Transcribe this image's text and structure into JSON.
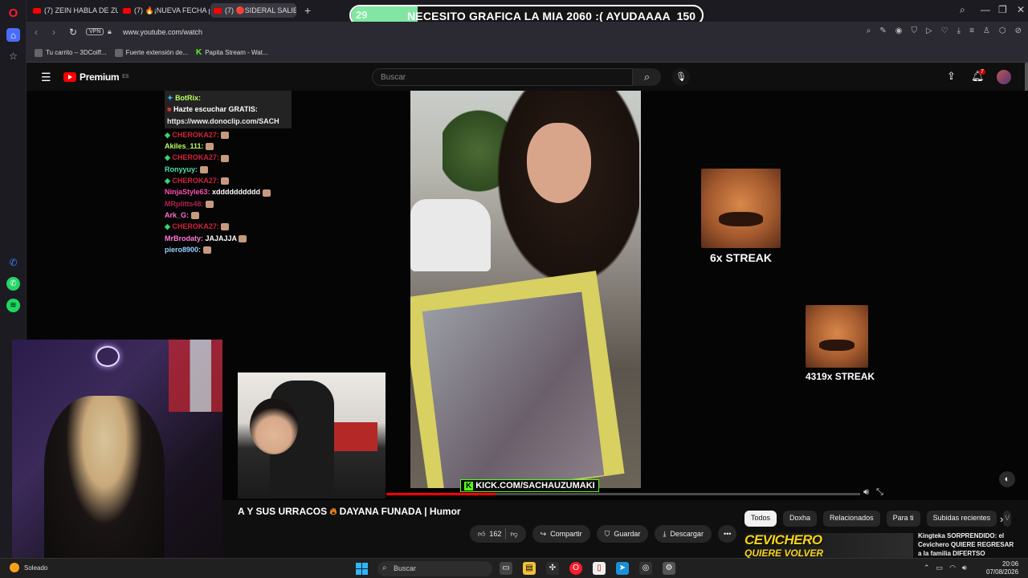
{
  "browser": {
    "tabs": [
      {
        "label": "(7) ZEIN HABLA DE ZULLY"
      },
      {
        "label": "(7) 🔥¡NUEVA FECHA par"
      },
      {
        "label": "(7) 🔴SIDERAL SALIE",
        "active": true
      }
    ],
    "url": "www.youtube.com/watch",
    "vpn_label": "VPN",
    "bookmarks": [
      {
        "label": "Tu carrito – 3DCoiff..."
      },
      {
        "label": "Fuerte extensión de..."
      },
      {
        "label": "Papita Stream - Wat..."
      }
    ]
  },
  "stream_overlay": {
    "left_number": "29",
    "goal_text": "NECESITO GRAFICA LA MIA 2060 :( AYUDAAAA",
    "right_number": "150",
    "progress_fraction": 0.19,
    "fill_color": "#82e6a2"
  },
  "youtube": {
    "logo_text": "Premium",
    "region": "ES",
    "search_placeholder": "Buscar",
    "notification_count": "7"
  },
  "chat": {
    "bot_name": "BotRix:",
    "bot_line": "Hazte escuchar GRATIS:",
    "bot_link": "https://www.donoclip.com/SACH",
    "messages": [
      {
        "user": "CHEROKA27:",
        "text": "",
        "color": "#d0223a",
        "badge": true
      },
      {
        "user": "Akiles_111:",
        "text": "",
        "color": "#b8ff5a",
        "badge": false
      },
      {
        "user": "CHEROKA27:",
        "text": "",
        "color": "#d0223a",
        "badge": true
      },
      {
        "user": "Ronyyuy:",
        "text": "",
        "color": "#4fe0a8",
        "badge": false
      },
      {
        "user": "CHEROKA27:",
        "text": "",
        "color": "#d0223a",
        "badge": true
      },
      {
        "user": "NinjaStyle63:",
        "text": "xdddddddddd",
        "color": "#ff4fb0",
        "badge": false
      },
      {
        "user": "MRplitts48:",
        "text": "",
        "color": "#b1224e",
        "badge": false
      },
      {
        "user": "Ark_G:",
        "text": "",
        "color": "#ff6fd0",
        "badge": false
      },
      {
        "user": "CHEROKA27:",
        "text": "",
        "color": "#d0223a",
        "badge": true
      },
      {
        "user": "MrBrodaty:",
        "text": "JAJAJJA",
        "color": "#ff7ad6",
        "badge": false
      },
      {
        "user": "piero8900:",
        "text": "",
        "color": "#9ad0ff",
        "badge": false
      }
    ]
  },
  "video": {
    "kick_tag": "KICK.COM/SACHAUZUMAKI",
    "streak_1": "6x STREAK",
    "streak_2": "4319x STREAK",
    "progress_fraction": 0.23,
    "title_prefix": "A Y SUS URRACOS",
    "title_suffix": "DAYANA FUNADA | Humor"
  },
  "actions": {
    "likes": "162",
    "share": "Compartir",
    "save": "Guardar",
    "download": "Descargar"
  },
  "chips": [
    "Todos",
    "Doxha",
    "Relacionados",
    "Para ti",
    "Subidas recientes",
    "V"
  ],
  "recommendation": {
    "thumb_line1": "CEVICHERO",
    "thumb_line2": "QUIERE VOLVER",
    "title": "Kingteka SORPRENDIDO: el Cevichero QUIERE REGRESAR a la familia DIFERTSO"
  },
  "taskbar": {
    "weather": "Soleado",
    "search": "Buscar",
    "time": "20:06",
    "date": "07/08/2026"
  }
}
